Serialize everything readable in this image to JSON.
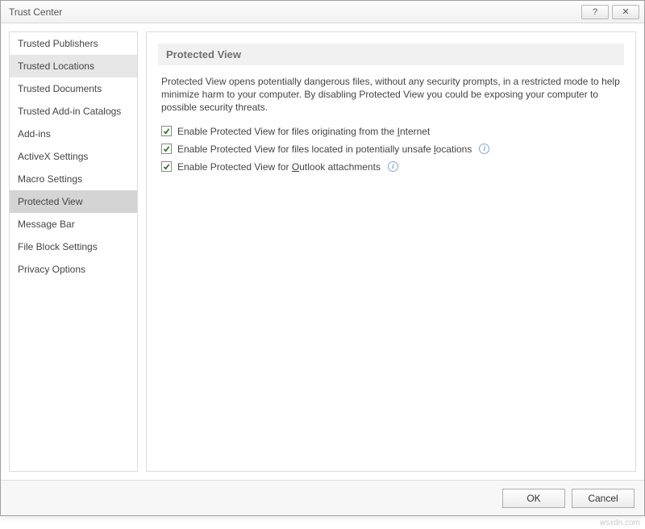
{
  "window": {
    "title": "Trust Center",
    "help_symbol": "?",
    "close_symbol": "✕"
  },
  "sidebar": {
    "items": [
      {
        "label": "Trusted Publishers",
        "selected": false,
        "highlight": false
      },
      {
        "label": "Trusted Locations",
        "selected": false,
        "highlight": true
      },
      {
        "label": "Trusted Documents",
        "selected": false,
        "highlight": false
      },
      {
        "label": "Trusted Add-in Catalogs",
        "selected": false,
        "highlight": false
      },
      {
        "label": "Add-ins",
        "selected": false,
        "highlight": false
      },
      {
        "label": "ActiveX Settings",
        "selected": false,
        "highlight": false
      },
      {
        "label": "Macro Settings",
        "selected": false,
        "highlight": false
      },
      {
        "label": "Protected View",
        "selected": true,
        "highlight": false
      },
      {
        "label": "Message Bar",
        "selected": false,
        "highlight": false
      },
      {
        "label": "File Block Settings",
        "selected": false,
        "highlight": false
      },
      {
        "label": "Privacy Options",
        "selected": false,
        "highlight": false
      }
    ]
  },
  "content": {
    "header": "Protected View",
    "description": "Protected View opens potentially dangerous files, without any security prompts, in a restricted mode to help minimize harm to your computer. By disabling Protected View you could be exposing your computer to possible security threats.",
    "options": [
      {
        "checked": true,
        "label_pre": "Enable Protected View for files originating from the ",
        "accel": "I",
        "label_post": "nternet",
        "info": false
      },
      {
        "checked": true,
        "label_pre": "Enable Protected View for files located in potentially unsafe ",
        "accel": "l",
        "label_post": "ocations",
        "info": true
      },
      {
        "checked": true,
        "label_pre": "Enable Protected View for ",
        "accel": "O",
        "label_post": "utlook attachments",
        "info": true
      }
    ]
  },
  "buttons": {
    "ok": "OK",
    "cancel": "Cancel"
  },
  "watermark": "wsxdn.com"
}
